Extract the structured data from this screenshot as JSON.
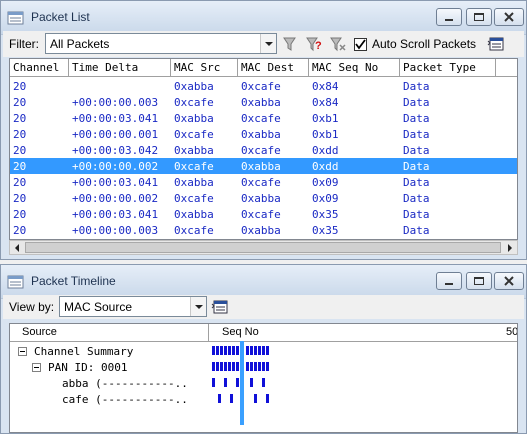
{
  "packet_list": {
    "title": "Packet List",
    "filter_label": "Filter:",
    "filter_value": "All Packets",
    "auto_scroll_label": "Auto Scroll Packets",
    "auto_scroll_checked": true,
    "columns": [
      "Channel",
      "Time Delta",
      "MAC Src",
      "MAC Dest",
      "MAC Seq No",
      "Packet Type"
    ],
    "rows": [
      {
        "channel": "20",
        "delta": "",
        "src": "0xabba",
        "dest": "0xcafe",
        "seq": "0x84",
        "type": "Data"
      },
      {
        "channel": "20",
        "delta": "+00:00:00.003",
        "src": "0xcafe",
        "dest": "0xabba",
        "seq": "0x84",
        "type": "Data"
      },
      {
        "channel": "20",
        "delta": "+00:00:03.041",
        "src": "0xabba",
        "dest": "0xcafe",
        "seq": "0xb1",
        "type": "Data"
      },
      {
        "channel": "20",
        "delta": "+00:00:00.001",
        "src": "0xcafe",
        "dest": "0xabba",
        "seq": "0xb1",
        "type": "Data"
      },
      {
        "channel": "20",
        "delta": "+00:00:03.042",
        "src": "0xabba",
        "dest": "0xcafe",
        "seq": "0xdd",
        "type": "Data"
      },
      {
        "channel": "20",
        "delta": "+00:00:00.002",
        "src": "0xcafe",
        "dest": "0xabba",
        "seq": "0xdd",
        "type": "Data",
        "selected": true
      },
      {
        "channel": "20",
        "delta": "+00:00:03.041",
        "src": "0xabba",
        "dest": "0xcafe",
        "seq": "0x09",
        "type": "Data"
      },
      {
        "channel": "20",
        "delta": "+00:00:00.002",
        "src": "0xcafe",
        "dest": "0xabba",
        "seq": "0x09",
        "type": "Data"
      },
      {
        "channel": "20",
        "delta": "+00:00:03.041",
        "src": "0xabba",
        "dest": "0xcafe",
        "seq": "0x35",
        "type": "Data"
      },
      {
        "channel": "20",
        "delta": "+00:00:00.003",
        "src": "0xcafe",
        "dest": "0xabba",
        "seq": "0x35",
        "type": "Data"
      }
    ]
  },
  "timeline": {
    "title": "Packet Timeline",
    "view_by_label": "View by:",
    "view_by_value": "MAC Source",
    "col_source": "Source",
    "col_seq": "Seq No",
    "col_end": "50",
    "tree": [
      {
        "label": "Channel Summary",
        "expander": true
      },
      {
        "label": "PAN ID: 0001",
        "expander": true
      },
      {
        "label": "abba (-----------..",
        "expander": false
      },
      {
        "label": "cafe (-----------..",
        "expander": false
      }
    ]
  },
  "colors": {
    "selection": "#3399ff",
    "row_text": "#1a29c4",
    "timeline_bar": "#1010d8",
    "timeline_cursor": "#3aa0ff"
  },
  "icons": [
    "packet-list-icon",
    "minimize-icon",
    "maximize-icon",
    "close-icon",
    "filter-edit-icon",
    "filter-help-icon",
    "filter-clear-icon",
    "columns-icon",
    "timeline-icon"
  ]
}
